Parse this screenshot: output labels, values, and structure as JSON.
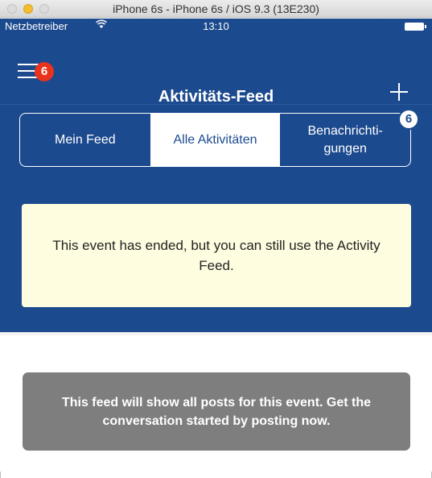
{
  "window": {
    "title": "iPhone 6s - iPhone 6s / iOS 9.3 (13E230)"
  },
  "statusbar": {
    "carrier": "Netzbetreiber",
    "wifi_icon": "wifi-icon",
    "time": "13:10",
    "battery_icon": "battery-icon"
  },
  "navbar": {
    "title": "Aktivitäts-Feed",
    "menu_badge": "6",
    "menu_icon": "hamburger-menu-icon",
    "add_icon": "plus-icon"
  },
  "segments": {
    "items": [
      {
        "label": "Mein Feed",
        "active": false
      },
      {
        "label": "Alle Aktivitäten",
        "active": true
      },
      {
        "label": "Benachrichti-\ngungen",
        "active": false
      }
    ],
    "notifications_badge": "6"
  },
  "banner": {
    "text": "This event has ended, but you can still use the Activity Feed."
  },
  "empty_state": {
    "text": "This feed will show all posts for this event. Get the conversation started by posting now."
  },
  "colors": {
    "brand_blue": "#1c4a8e",
    "badge_red": "#e8331d",
    "banner_bg": "#fffde0",
    "info_gray": "#7e7e7e"
  }
}
